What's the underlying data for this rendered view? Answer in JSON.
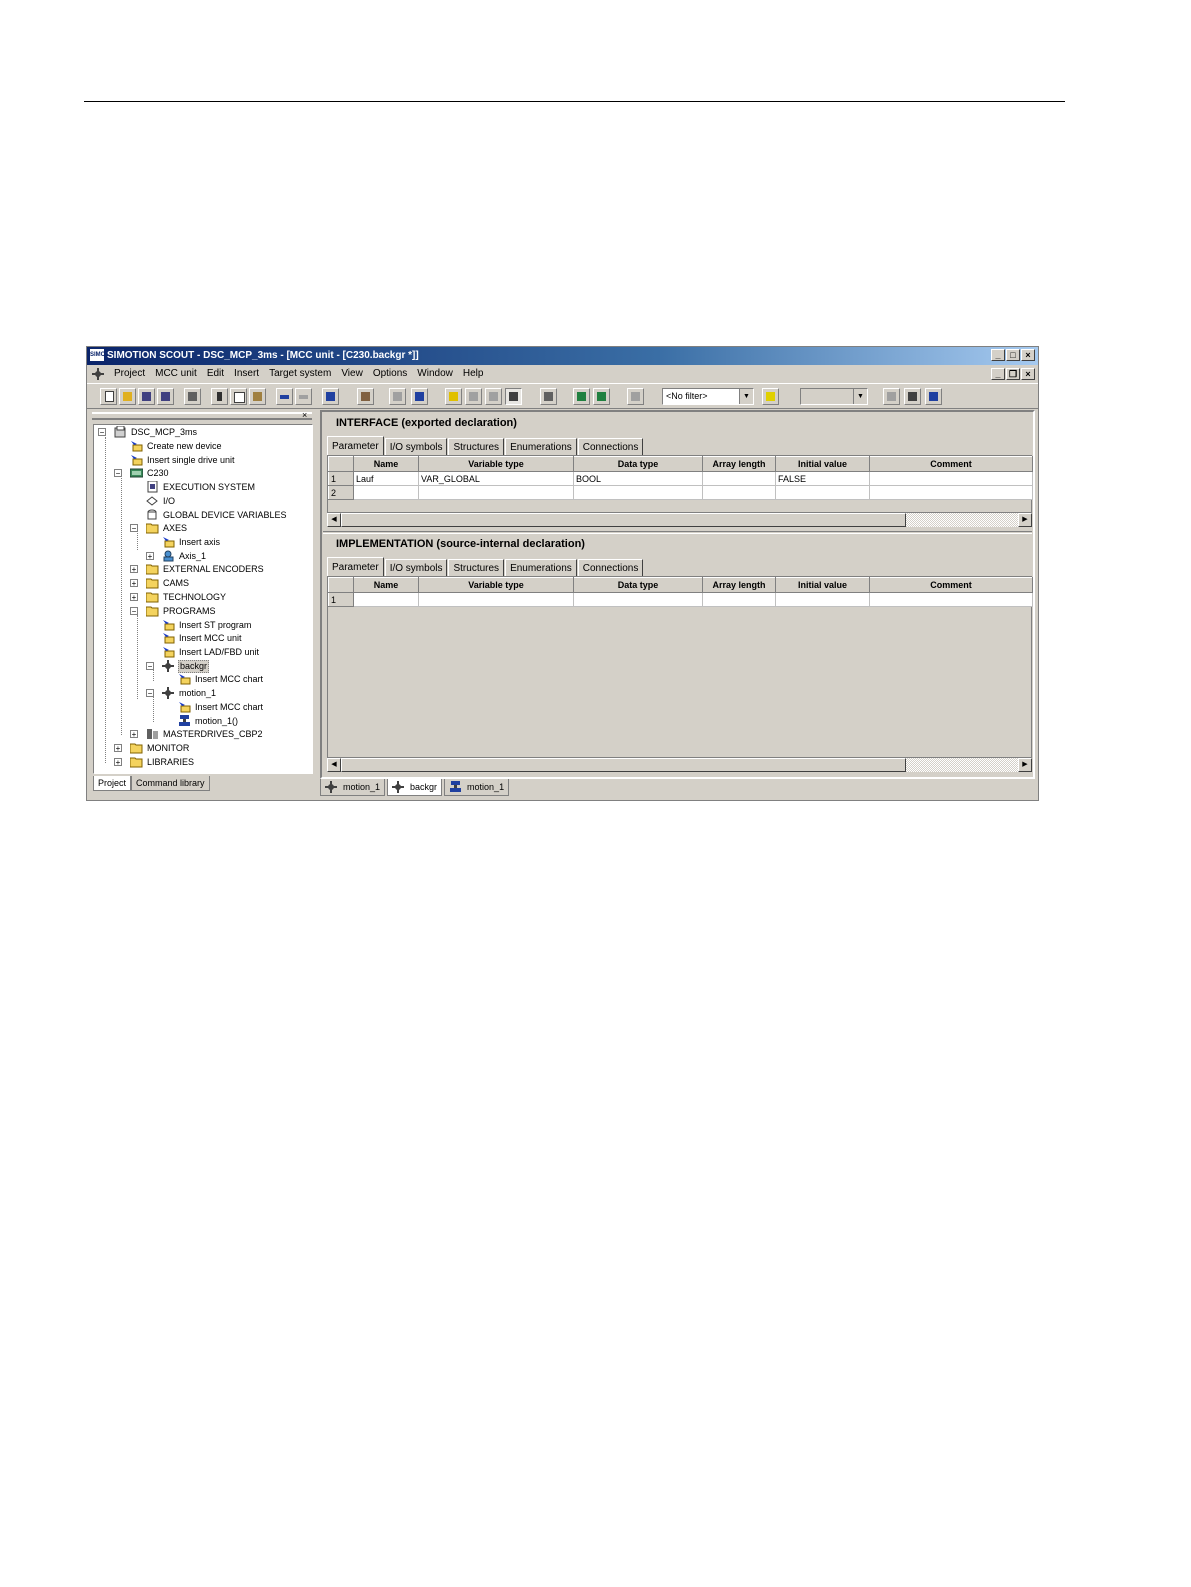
{
  "window": {
    "title": "SIMOTION SCOUT - DSC_MCP_3ms - [MCC unit - [C230.backgr *]]",
    "logo_text": "SIMO"
  },
  "menu": [
    "Project",
    "MCC unit",
    "Edit",
    "Insert",
    "Target system",
    "View",
    "Options",
    "Window",
    "Help"
  ],
  "toolbar": {
    "filter_combo": "<No filter>",
    "second_combo": ""
  },
  "tree": {
    "close_label": "×",
    "items": [
      {
        "label": "DSC_MCP_3ms",
        "icon": "project-icon"
      },
      {
        "label": "Create new device",
        "icon": "insert-icon"
      },
      {
        "label": "Insert single drive unit",
        "icon": "insert-icon"
      },
      {
        "label": "C230",
        "icon": "device-icon"
      },
      {
        "label": "EXECUTION SYSTEM",
        "icon": "execution-icon"
      },
      {
        "label": "I/O",
        "icon": "io-icon"
      },
      {
        "label": "GLOBAL DEVICE VARIABLES",
        "icon": "variables-icon"
      },
      {
        "label": "AXES",
        "icon": "folder-icon"
      },
      {
        "label": "Insert axis",
        "icon": "insert-icon"
      },
      {
        "label": "Axis_1",
        "icon": "axis-icon"
      },
      {
        "label": "EXTERNAL ENCODERS",
        "icon": "folder-icon"
      },
      {
        "label": "CAMS",
        "icon": "folder-icon"
      },
      {
        "label": "TECHNOLOGY",
        "icon": "folder-icon"
      },
      {
        "label": "PROGRAMS",
        "icon": "folder-icon"
      },
      {
        "label": "Insert ST program",
        "icon": "insert-icon"
      },
      {
        "label": "Insert MCC unit",
        "icon": "insert-icon"
      },
      {
        "label": "Insert LAD/FBD unit",
        "icon": "insert-icon"
      },
      {
        "label": "backgr",
        "icon": "mcc-unit-icon"
      },
      {
        "label": "Insert MCC chart",
        "icon": "insert-icon"
      },
      {
        "label": "motion_1",
        "icon": "mcc-unit-icon"
      },
      {
        "label": "Insert MCC chart",
        "icon": "insert-icon"
      },
      {
        "label": "motion_1()",
        "icon": "mcc-chart-icon"
      },
      {
        "label": "MASTERDRIVES_CBP2",
        "icon": "drive-icon"
      },
      {
        "label": "MONITOR",
        "icon": "folder-icon"
      },
      {
        "label": "LIBRARIES",
        "icon": "folder-icon"
      }
    ],
    "tabs": [
      "Project",
      "Command library"
    ]
  },
  "tabs": [
    "Parameter",
    "I/O symbols",
    "Structures",
    "Enumerations",
    "Connections"
  ],
  "columns": [
    "Name",
    "Variable type",
    "Data type",
    "Array length",
    "Initial value",
    "Comment"
  ],
  "interface": {
    "title": "INTERFACE (exported declaration)",
    "rows": [
      {
        "num": "1",
        "name": "Lauf",
        "vartype": "VAR_GLOBAL",
        "datatype": "BOOL",
        "arraylen": "",
        "initial": "FALSE",
        "comment": ""
      },
      {
        "num": "2",
        "name": "",
        "vartype": "",
        "datatype": "",
        "arraylen": "",
        "initial": "",
        "comment": ""
      }
    ]
  },
  "implementation": {
    "title": "IMPLEMENTATION (source-internal declaration)",
    "rows": [
      {
        "num": "1",
        "name": "",
        "vartype": "",
        "datatype": "",
        "arraylen": "",
        "initial": "",
        "comment": ""
      }
    ]
  },
  "scroll_arrows": {
    "left": "◀",
    "right": "▶"
  },
  "bottom_tabs": [
    {
      "label": "motion_1",
      "icon": "mcc-unit-icon"
    },
    {
      "label": "backgr",
      "icon": "mcc-unit-icon"
    },
    {
      "label": "motion_1",
      "icon": "mcc-chart-icon"
    }
  ],
  "colors": {
    "title_bar_start": "#0a246a",
    "title_bar_end": "#a6caf0",
    "face": "#d4d0c8",
    "folder": "#f4d35e",
    "insert_arrow": "#1a3cc8"
  }
}
